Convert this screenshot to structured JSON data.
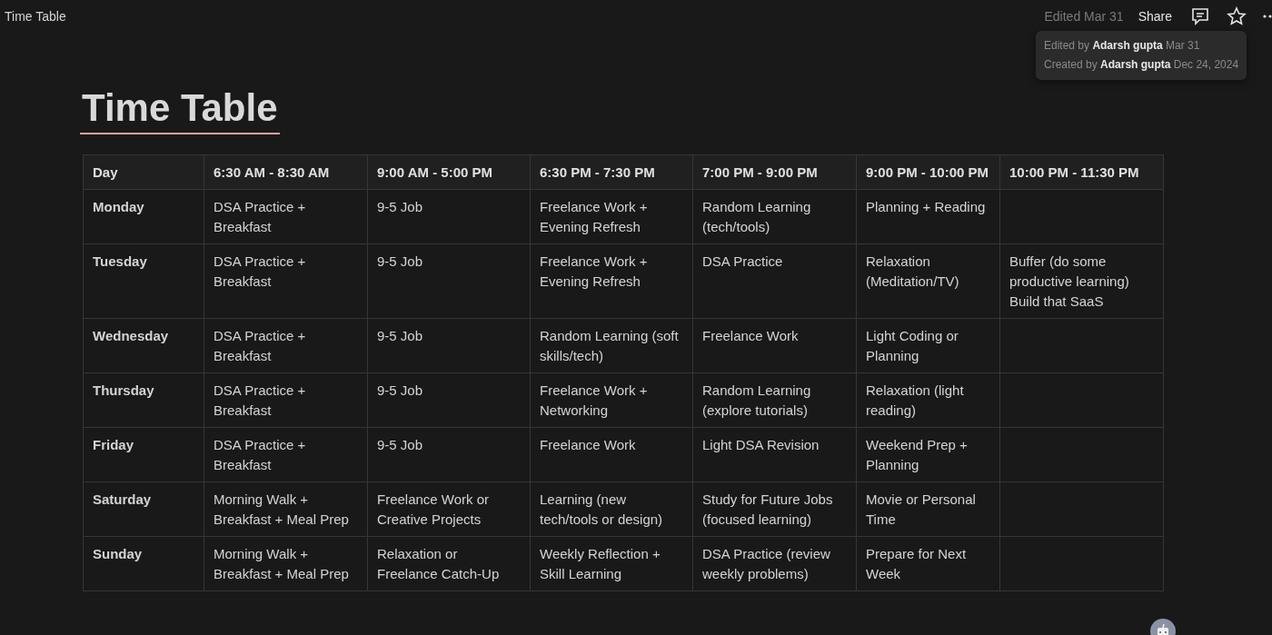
{
  "topbar": {
    "breadcrumb": "Time Table",
    "edited": "Edited Mar 31",
    "share": "Share"
  },
  "info_popup": {
    "lines": [
      "Edited by **Adarsh gupta** Mar 31",
      "Created by **Adarsh gupta** Dec 24, 2024"
    ]
  },
  "page": {
    "title": "Time Table"
  },
  "table": {
    "columns": [
      "Day",
      "6:30 AM - 8:30 AM",
      "9:00 AM - 5:00 PM",
      "6:30 PM - 7:30 PM",
      "7:00 PM - 9:00 PM",
      "9:00 PM - 10:00 PM",
      "10:00 PM - 11:30 PM"
    ],
    "rows": [
      [
        "Monday",
        "DSA Practice + Breakfast",
        "9-5 Job",
        "Freelance Work + Evening Refresh",
        "Random Learning (tech/tools)",
        "Planning + Reading",
        ""
      ],
      [
        "Tuesday",
        "DSA Practice + Breakfast",
        "9-5 Job",
        "Freelance Work + Evening Refresh",
        "DSA Practice",
        "Relaxation (Meditation/TV)",
        "Buffer (do some productive learning)\nBuild that SaaS"
      ],
      [
        "Wednesday",
        "DSA Practice + Breakfast",
        "9-5 Job",
        "Random Learning (soft skills/tech)",
        "Freelance Work",
        "Light Coding or Planning",
        ""
      ],
      [
        "Thursday",
        "DSA Practice + Breakfast",
        "9-5 Job",
        "Freelance Work + Networking",
        "Random Learning (explore tutorials)",
        "Relaxation (light reading)",
        ""
      ],
      [
        "Friday",
        "DSA Practice + Breakfast",
        "9-5 Job",
        "Freelance Work",
        "Light DSA Revision",
        "Weekend Prep + Planning",
        ""
      ],
      [
        "Saturday",
        "Morning Walk + Breakfast + Meal Prep",
        "Freelance Work or Creative Projects",
        "Learning (new tech/tools or design)",
        "Study for Future Jobs (focused learning)",
        "Movie or Personal Time",
        ""
      ],
      [
        "Sunday",
        "Morning Walk + Breakfast + Meal Prep",
        "Relaxation or Freelance Catch-Up",
        "Weekly Reflection + Skill Learning",
        "DSA Practice (review weekly problems)",
        "Prepare for Next Week",
        ""
      ]
    ]
  }
}
